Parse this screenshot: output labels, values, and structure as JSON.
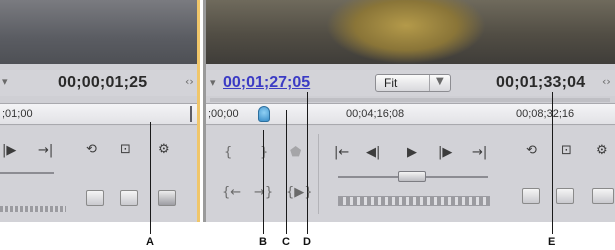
{
  "source": {
    "timecode": "00;00;01;25",
    "ruler_label": ";01;00"
  },
  "program": {
    "current_timecode": "00;01;27;05",
    "zoom_value": "Fit",
    "duration_timecode": "00;01;33;04",
    "ruler_ticks": [
      ";00;00",
      "00;04;16;08",
      "00;08;32;16"
    ]
  },
  "callouts": [
    "A",
    "B",
    "C",
    "D",
    "E"
  ],
  "colors": {
    "source_panel_border": "#f0c66a",
    "timecode_link": "#3b3bc4",
    "playhead": "#3a8ec9",
    "panel_bg": "#cfcfd4"
  }
}
